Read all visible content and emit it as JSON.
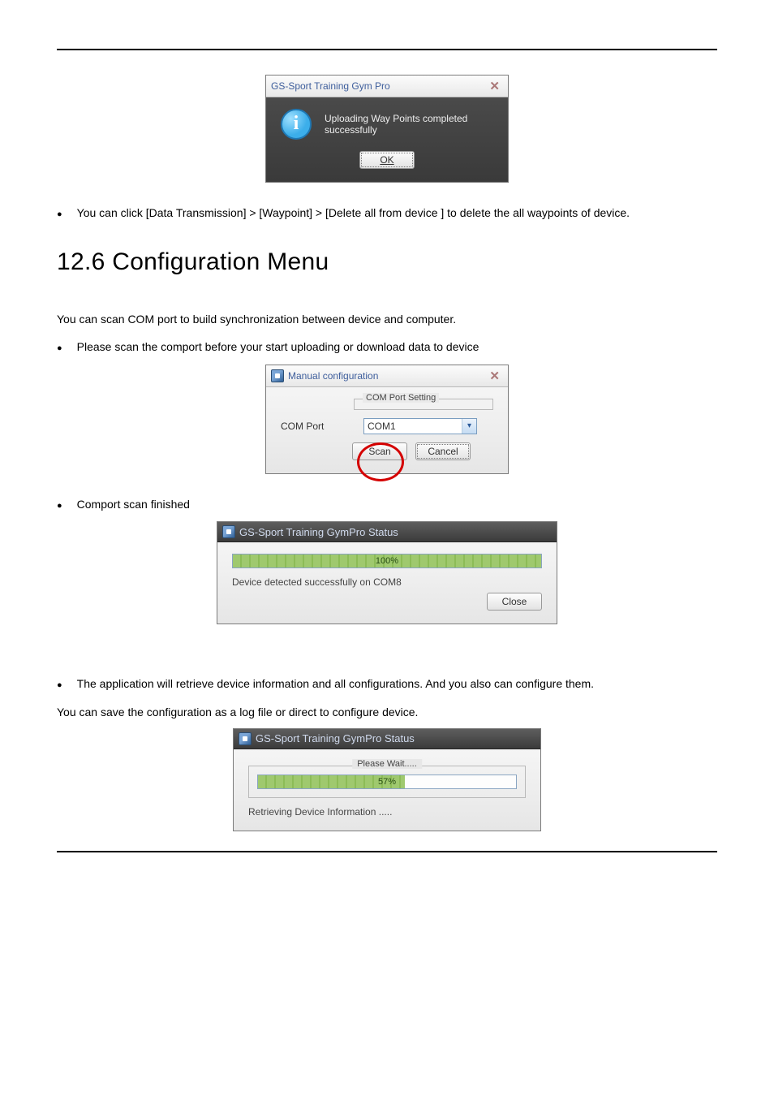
{
  "upload_dialog": {
    "title": "GS-Sport Training Gym Pro",
    "message": "Uploading Way Points completed successfully",
    "ok_label": "OK"
  },
  "bullets": {
    "b1": "You can click [Data Transmission] > [Waypoint] > [Delete all from device ] to delete the all waypoints of device.",
    "b2": "Please scan the comport before your start uploading or download data to device",
    "b3": "Comport scan finished",
    "b4": "The application will retrieve device information and all configurations. And you also can configure them."
  },
  "section_title": "12.6 Configuration Menu",
  "lead_text": "You can scan COM port to build synchronization between device and computer.",
  "save_text": "You can save the configuration as a log file or direct to configure device.",
  "manual_dialog": {
    "title": "Manual configuration",
    "group_label": "COM Port Setting",
    "field_label": "COM Port",
    "combo_value": "COM1",
    "scan_label": "Scan",
    "cancel_label": "Cancel"
  },
  "status_dialog_100": {
    "title": "GS-Sport Training GymPro Status",
    "percent_text": "100%",
    "percent_value": 100,
    "status_text": "Device detected successfully on COM8",
    "close_label": "Close"
  },
  "status_dialog_57": {
    "title": "GS-Sport Training GymPro Status",
    "wait_label": "Please Wait.....",
    "percent_text": "57%",
    "percent_value": 57,
    "status_text": "Retrieving Device Information ....."
  }
}
